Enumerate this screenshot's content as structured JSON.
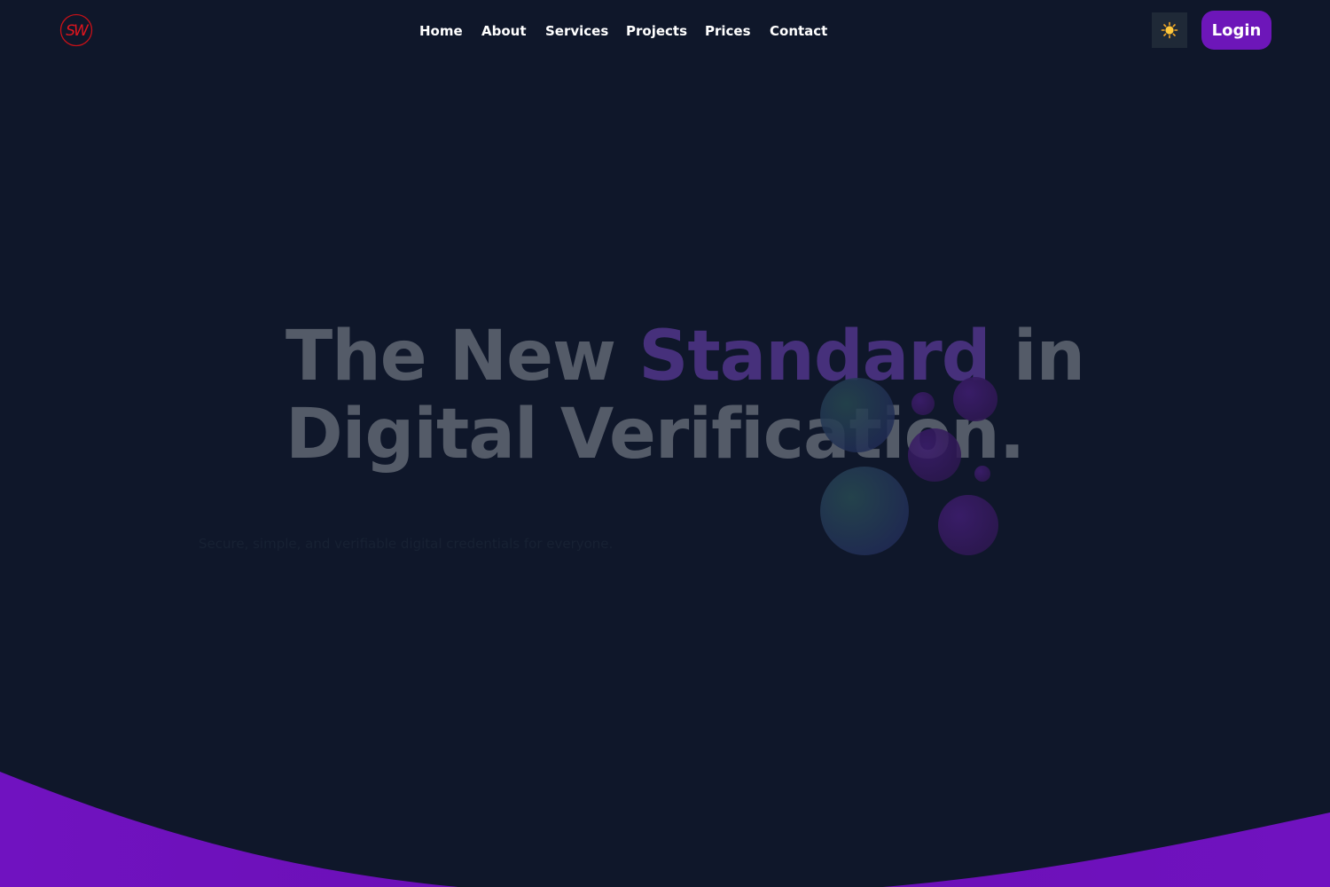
{
  "brand": {
    "logo_text": "SW",
    "logo_color": "#e0151e"
  },
  "nav": {
    "items": [
      {
        "label": "Home"
      },
      {
        "label": "About"
      },
      {
        "label": "Services"
      },
      {
        "label": "Projects"
      },
      {
        "label": "Prices"
      },
      {
        "label": "Contact"
      }
    ]
  },
  "header": {
    "theme_toggle_icon": "sun-icon",
    "login_label": "Login"
  },
  "hero": {
    "title_part1": "The New ",
    "title_accent": "Standard",
    "title_part2": " in",
    "title_line2": "Digital Verification.",
    "subtitle": "Secure, simple, and verifiable digital credentials for everyone."
  },
  "colors": {
    "background": "#0f172a",
    "accent": "#6d16b9",
    "title": "#545b68",
    "title_accent": "#46307b",
    "teal_bubble": "#23424f",
    "purple_bubble": "#3b1a6b"
  }
}
